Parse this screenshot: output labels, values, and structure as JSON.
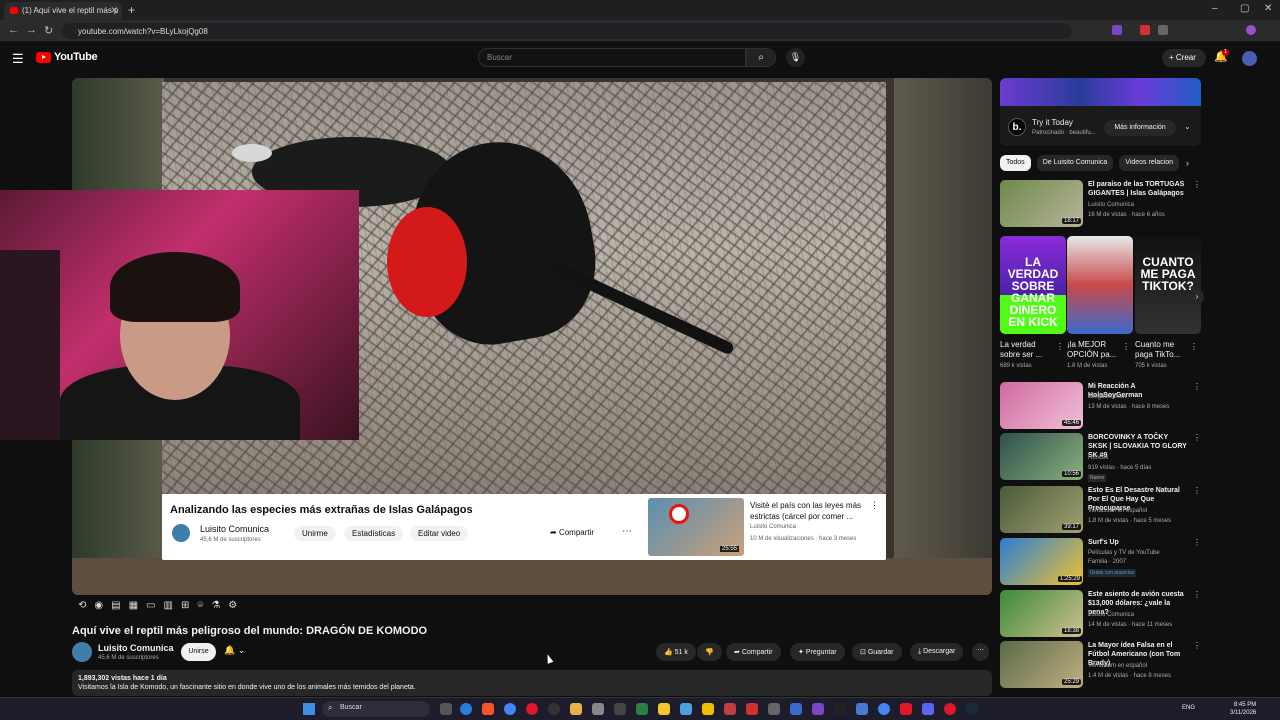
{
  "browser": {
    "tab_title": "(1) Aquí vive el reptil más p",
    "url": "youtube.com/watch?v=BLyLkojQg08",
    "new_tab": "+"
  },
  "header": {
    "brand": "YouTube",
    "search_placeholder": "Buscar",
    "create_label": "Crear",
    "notifications_count": "1"
  },
  "player": {
    "embedded_title": "Analizando las especies más extrañas de Islas Galápagos",
    "embedded_channel": "Luisito Comunica",
    "embedded_subs": "45,6 M de suscriptores",
    "buttons": [
      "Unirme",
      "Estadísticas",
      "Editar video"
    ],
    "share_label": "Compartir",
    "rec_title": "Visité el país con las leyes más estrictas (cárcel por comer ...",
    "rec_channel": "Luisito Comunica",
    "rec_meta": "10 M de visualizaciones · hace 3 meses",
    "rec_duration": "25:55"
  },
  "video": {
    "title": "Aquí vive el reptil más peligroso del mundo: DRAGÓN DE KOMODO",
    "channel": "Luisito Comunica",
    "subs": "45,6 M de suscriptores",
    "join_label": "Unirse",
    "likes": "51 k",
    "actions": [
      "Compartir",
      "Preguntar",
      "Guardar",
      "Descargar"
    ],
    "views_line": "1,893,302 vistas  hace 1 día",
    "description": "Visitamos la Isla de Komodo, un fascinante sitio en donde vive uno de los animales más temidos del planeta."
  },
  "ad": {
    "title": "Try it Today",
    "sponsor": "Patrocinado · beautifu...",
    "more_label": "Más información"
  },
  "chips": [
    "Todos",
    "De Luisito Comunica",
    "Videos relacion"
  ],
  "recommendations": [
    {
      "title": "El paraíso de las TORTUGAS GIGANTES | Islas Galápagos",
      "channel": "Luisito Comunica",
      "meta": "16 M de vistas · hace 6 años",
      "duration": "18:17"
    },
    {
      "title": "Mi Reacción A HolaSoyGerman",
      "channel": "JuegaGerman",
      "meta": "13 M de vistas · hace 8 meses",
      "duration": "45:46"
    },
    {
      "title": "BORCOVINKY A TOČKY SKSK | SLOVAKIA TO GLORY SK #9",
      "channel": "Roncek",
      "meta": "919 vistas · hace 5 días",
      "duration": "10:56",
      "badge": "Nuevo"
    },
    {
      "title": "Esto Es El Desastre Natural Por El Que Hay Que Preocuparse",
      "channel": "Veritasium en español",
      "meta": "1.8 M de vistas · hace 5 meses",
      "duration": "39:17"
    },
    {
      "title": "Surf's Up",
      "channel": "Películas y TV de YouTube",
      "meta": "Familia · 2007",
      "duration": "1:25:29",
      "badge": "Gratis con anuncios"
    },
    {
      "title": "Este asiento de avión cuesta $13,000 dólares: ¿vale la pena?",
      "channel": "Luisito Comunica",
      "meta": "14 M de vistas · hace 11 meses",
      "duration": "18:38"
    },
    {
      "title": "La Mayor idea Falsa en el Fútbol Americano (con Tom Brady)",
      "channel": "Veritasium en español",
      "meta": "1.4 M de vistas · hace 8 meses",
      "duration": "25:29"
    }
  ],
  "shorts": [
    {
      "label": "La verdad sobre ser ...",
      "views": "689 k vistas",
      "big": "LA VERDAD SOBRE GANAR DINERO EN KICK"
    },
    {
      "label": "¡la MEJOR OPCIÓN pa...",
      "views": "1.8 M de vistas",
      "big": ""
    },
    {
      "label": "Cuanto me paga TikTo...",
      "views": "705 k vistas",
      "big": "CUANTO ME PAGA TIKTOK?"
    }
  ],
  "taskbar": {
    "search": "Buscar",
    "lang": "ENG",
    "time": "8:45 PM",
    "date": "3/11/2026"
  },
  "colors": {
    "brand_red": "#ff0000",
    "bg": "#0f0f0f",
    "chip": "#272727"
  }
}
